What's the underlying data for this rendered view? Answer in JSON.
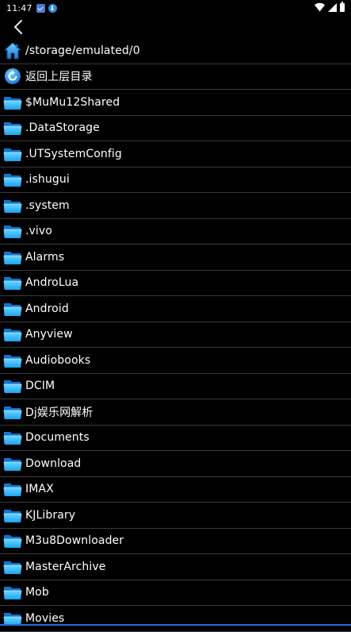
{
  "status_bar": {
    "time": "11:47",
    "notification_icons": [
      "mail-icon",
      "download-icon"
    ],
    "system_icons": [
      "wifi-icon",
      "signal-icon",
      "battery-icon"
    ]
  },
  "toolbar": {
    "back_icon": "chevron-left-icon"
  },
  "path_row": {
    "icon": "home-icon",
    "label": "/storage/emulated/0"
  },
  "up_row": {
    "icon": "return-icon",
    "label": "返回上层目录"
  },
  "folders": [
    {
      "label": "$MuMu12Shared"
    },
    {
      "label": ".DataStorage"
    },
    {
      "label": ".UTSystemConfig"
    },
    {
      "label": ".ishugui"
    },
    {
      "label": ".system"
    },
    {
      "label": ".vivo"
    },
    {
      "label": "Alarms"
    },
    {
      "label": "AndroLua"
    },
    {
      "label": "Android"
    },
    {
      "label": "Anyview"
    },
    {
      "label": "Audiobooks"
    },
    {
      "label": "DCIM"
    },
    {
      "label": "Dj娱乐网解析"
    },
    {
      "label": "Documents"
    },
    {
      "label": "Download"
    },
    {
      "label": "IMAX"
    },
    {
      "label": "KJLibrary"
    },
    {
      "label": "M3u8Downloader"
    },
    {
      "label": "MasterArchive"
    },
    {
      "label": "Mob"
    },
    {
      "label": "Movies"
    }
  ],
  "colors": {
    "background": "#000000",
    "divider": "#3a3a3a",
    "folder_blue": "#1aa3f0",
    "accent": "#1e6fd9"
  }
}
